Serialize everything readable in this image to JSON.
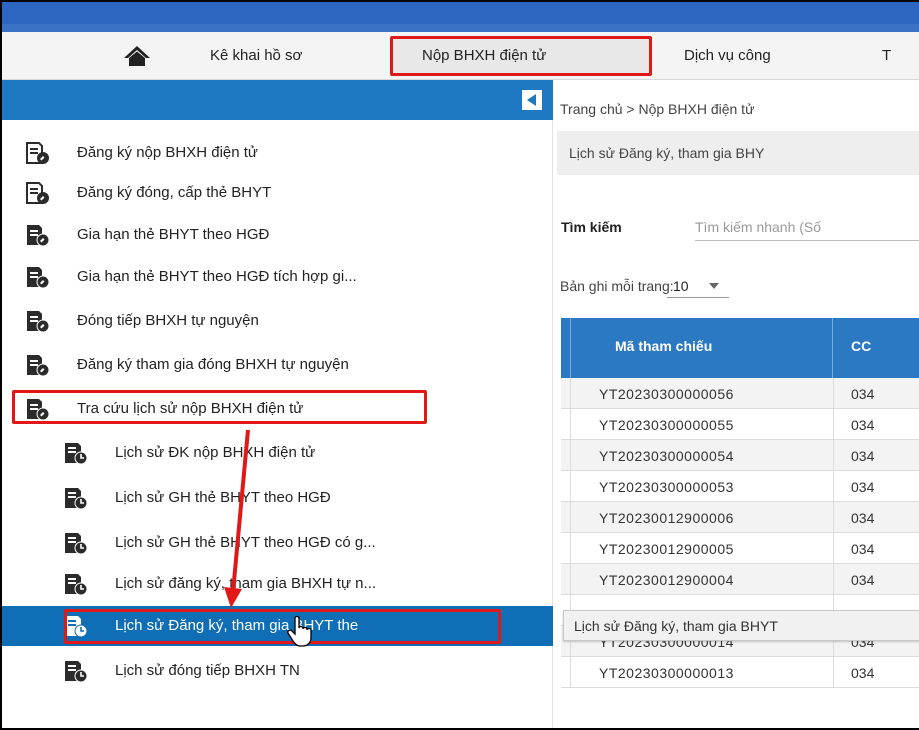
{
  "colors": {
    "top_strip": "#2c66c0",
    "sidebar_header": "#1e78c2",
    "active_item": "#0f6eb5",
    "table_header": "#2b79c3",
    "annotation_red": "#e01818"
  },
  "nav": {
    "home_icon": "home-icon",
    "items": [
      "Kê khai hồ sơ",
      "Nộp BHXH điện tử",
      "Dịch vụ công",
      "T"
    ]
  },
  "sidebar": {
    "collapse_icon": "collapse-left-icon",
    "items": [
      {
        "label": "Đăng ký nộp BHXH điện tử",
        "icon": "document-edit-icon"
      },
      {
        "label": "Đăng ký đóng, cấp thẻ BHYT",
        "icon": "document-edit-icon"
      },
      {
        "label": "Gia hạn thẻ BHYT theo HGĐ",
        "icon": "document-edit-icon"
      },
      {
        "label": "Gia hạn thẻ BHYT theo HGĐ tích hợp gi...",
        "icon": "document-edit-icon"
      },
      {
        "label": "Đóng tiếp BHXH tự nguyện",
        "icon": "document-edit-icon"
      },
      {
        "label": "Đăng ký tham gia đóng BHXH tự nguyện",
        "icon": "document-edit-icon"
      },
      {
        "label": "Tra cứu lịch sử nộp BHXH điện tử",
        "icon": "document-edit-icon"
      }
    ],
    "subitems": [
      {
        "label": "Lịch sử ĐK nộp BHXH điện tử",
        "icon": "document-history-icon"
      },
      {
        "label": "Lịch sử GH thẻ BHYT theo HGĐ",
        "icon": "document-history-icon"
      },
      {
        "label": "Lịch sử GH thẻ BHYT theo HGĐ có g...",
        "icon": "document-history-icon"
      },
      {
        "label": "Lịch sử đăng ký, tham gia BHXH tự n...",
        "icon": "document-history-icon"
      },
      {
        "label": "Lịch sử Đăng ký, tham gia BHYT the",
        "icon": "document-history-icon"
      },
      {
        "label": "Lịch sử đóng tiếp BHXH TN",
        "icon": "document-history-icon"
      }
    ]
  },
  "main": {
    "breadcrumb": "Trang chủ  >  Nộp BHXH điện tử",
    "history_title": "Lịch sử Đăng ký, tham gia BHY",
    "search": {
      "label": "Tìm kiếm",
      "placeholder": "Tìm kiếm nhanh (Số"
    },
    "pagesize": {
      "label": "Bản ghi mỗi trang:",
      "value": "10"
    },
    "table": {
      "columns": [
        "Mã tham chiếu",
        "CC"
      ],
      "rows": [
        [
          "YT20230300000056",
          "034"
        ],
        [
          "YT20230300000055",
          "034"
        ],
        [
          "YT20230300000054",
          "034"
        ],
        [
          "YT20230300000053",
          "034"
        ],
        [
          "YT20230012900006",
          "034"
        ],
        [
          "YT20230012900005",
          "034"
        ],
        [
          "YT20230012900004",
          "034"
        ],
        [
          "",
          ""
        ],
        [
          "YT20230300000014",
          "034"
        ],
        [
          "YT20230300000013",
          "034"
        ]
      ]
    },
    "tooltip": "Lịch sử Đăng ký, tham gia BHYT"
  }
}
